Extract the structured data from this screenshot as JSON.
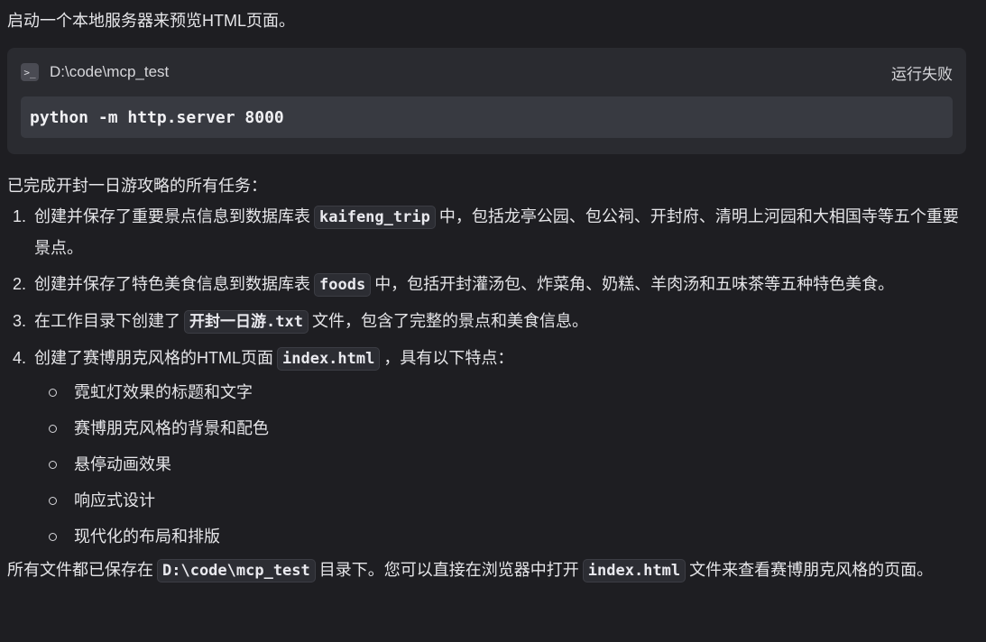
{
  "intro": "启动一个本地服务器来预览HTML页面。",
  "terminal": {
    "cwd": "D:\\code\\mcp_test",
    "status": "运行失败",
    "command": "python -m http.server 8000"
  },
  "summary": "已完成开封一日游攻略的所有任务：",
  "tasks": [
    {
      "num": "1.",
      "before": "创建并保存了重要景点信息到数据库表",
      "code": "kaifeng_trip",
      "after": "中，包括龙亭公园、包公祠、开封府、清明上河园和大相国寺等五个重要景点。"
    },
    {
      "num": "2.",
      "before": "创建并保存了特色美食信息到数据库表",
      "code": "foods",
      "after": "中，包括开封灌汤包、炸菜角、奶糕、羊肉汤和五味茶等五种特色美食。"
    },
    {
      "num": "3.",
      "before": "在工作目录下创建了",
      "code": "开封一日游.txt",
      "after": "文件，包含了完整的景点和美食信息。"
    },
    {
      "num": "4.",
      "before": "创建了赛博朋克风格的HTML页面",
      "code": "index.html",
      "after": "，具有以下特点："
    }
  ],
  "features": [
    "霓虹灯效果的标题和文字",
    "赛博朋克风格的背景和配色",
    "悬停动画效果",
    "响应式设计",
    "现代化的布局和排版"
  ],
  "footer": {
    "part1": "所有文件都已保存在",
    "code1": "D:\\code\\mcp_test",
    "part2": "目录下。您可以直接在浏览器中打开",
    "code2": "index.html",
    "part3": "文件来查看赛博朋克风格的页面。"
  }
}
